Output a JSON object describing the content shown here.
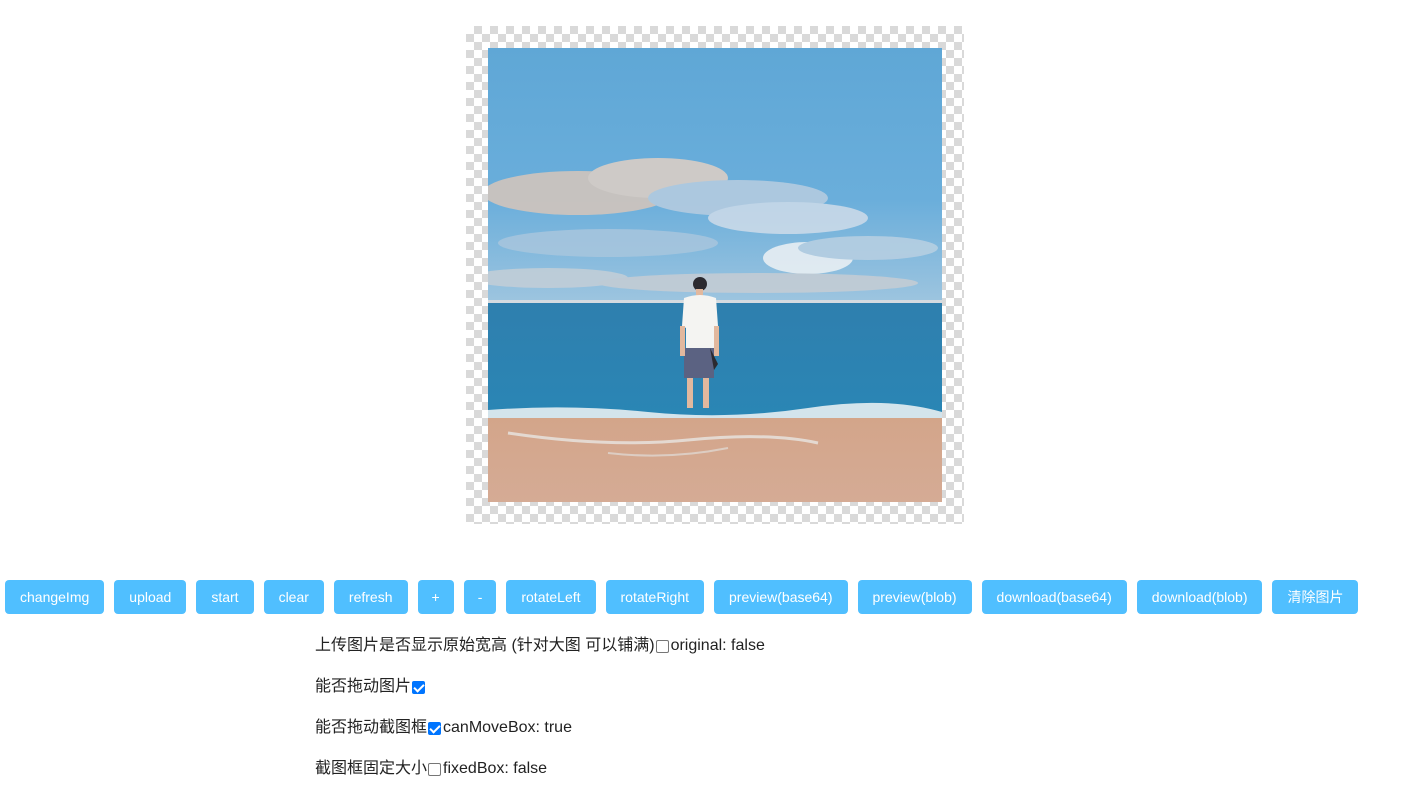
{
  "toolbar": {
    "buttons": [
      {
        "label": "changeImg"
      },
      {
        "label": "upload"
      },
      {
        "label": "start"
      },
      {
        "label": "clear"
      },
      {
        "label": "refresh"
      },
      {
        "label": "+"
      },
      {
        "label": "-"
      },
      {
        "label": "rotateLeft"
      },
      {
        "label": "rotateRight"
      },
      {
        "label": "preview(base64)"
      },
      {
        "label": "preview(blob)"
      },
      {
        "label": "download(base64)"
      },
      {
        "label": "download(blob)"
      },
      {
        "label": "清除图片"
      }
    ],
    "button_color": "#50bfff"
  },
  "options": {
    "original": {
      "label": "上传图片是否显示原始宽高 (针对大图 可以铺满)",
      "checked": false,
      "status": "original: false"
    },
    "can_move": {
      "label": "能否拖动图片",
      "checked": true
    },
    "can_move_box": {
      "label": "能否拖动截图框",
      "checked": true,
      "status": "canMoveBox: true"
    },
    "fixed_box": {
      "label": "截图框固定大小",
      "checked": false,
      "status": "fixedBox: false"
    }
  },
  "colors": {
    "checkbox_checked": "#0075ff"
  }
}
